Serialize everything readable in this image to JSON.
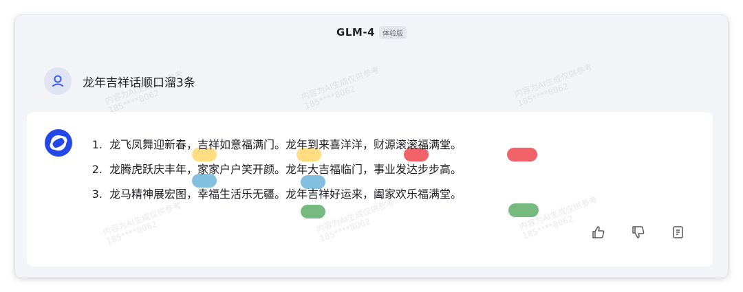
{
  "header": {
    "model_name": "GLM-4",
    "badge": "体验版"
  },
  "user_message": {
    "text": "龙年吉祥话顺口溜3条"
  },
  "answer": {
    "items": [
      {
        "num": "1.",
        "text": "龙飞凤舞迎新春，吉祥如意福满门。龙年到来喜洋洋，财源滚滚福满堂。"
      },
      {
        "num": "2.",
        "text": "龙腾虎跃庆丰年，家家户户笑开颜。龙年大吉福临门，事业发达步步高。"
      },
      {
        "num": "3.",
        "text": "龙马精神展宏图，幸福生活乐无疆。龙年吉祥好运来，阖家欢乐福满堂。"
      }
    ]
  },
  "actions": [
    {
      "name": "thumbs-up-icon"
    },
    {
      "name": "thumbs-down-icon"
    },
    {
      "name": "copy-icon"
    }
  ],
  "marks": {
    "yellow": "#ffd76a",
    "red": "#f0474f",
    "blue": "#6db4dc",
    "green": "#5fae68"
  },
  "watermark": {
    "line1": "内容为AI生成仅供参考",
    "line2": "185****8062"
  }
}
